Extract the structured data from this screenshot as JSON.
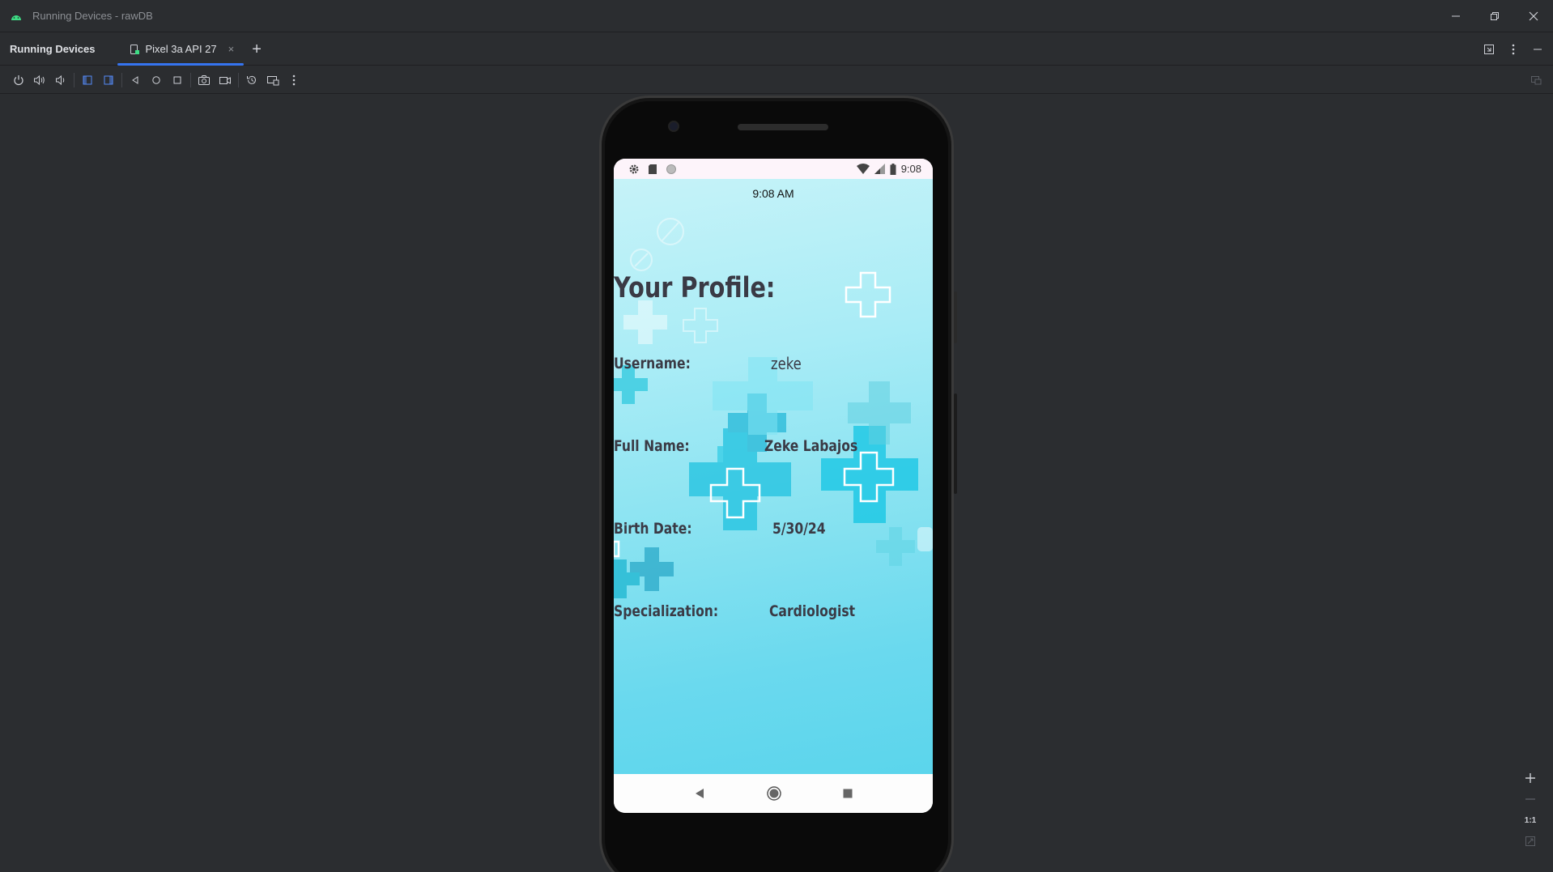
{
  "window": {
    "title": "Running Devices - rawDB"
  },
  "panel": {
    "title": "Running Devices",
    "tab_label": "Pixel 3a API 27"
  },
  "device": {
    "status_time": "9:08",
    "app_clock": "9:08 AM"
  },
  "profile": {
    "heading": "Your Profile:",
    "username_label": "Username:",
    "username_value": "zeke",
    "fullname_label": "Full Name:",
    "fullname_value": "Zeke Labajos",
    "birthdate_label": "Birth Date:",
    "birthdate_value": "5/30/24",
    "specialization_label": "Specialization:",
    "specialization_value": "Cardiologist"
  },
  "zoom": {
    "actual_size_label": "1:1"
  },
  "colors": {
    "accent": "#3574f0",
    "ide_background": "#2b2d30",
    "app_gradient_top": "#c6f3f8",
    "app_gradient_bottom": "#5bd5ec",
    "text_dark": "#3a3a45"
  }
}
